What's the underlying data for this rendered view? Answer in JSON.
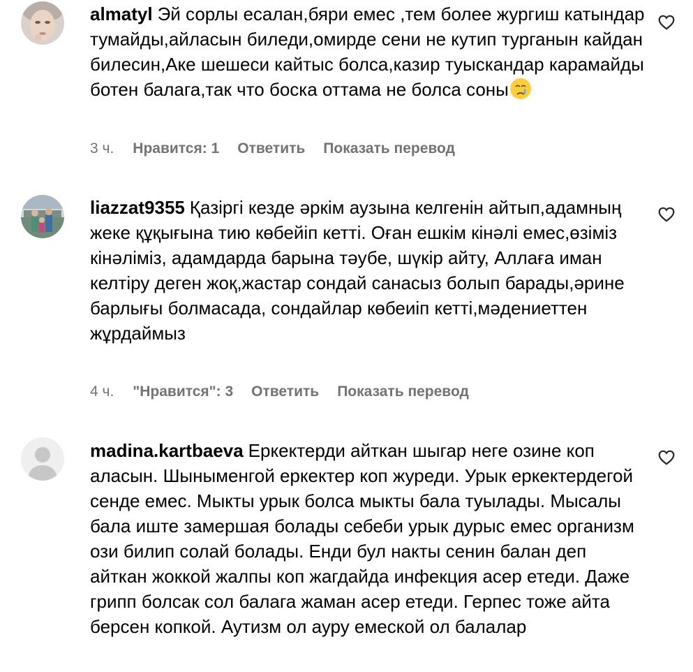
{
  "comments": [
    {
      "username": "almatyl",
      "text": "Эй сорлы есалан,бяри емес ,тем более жургиш катындар тумайды,айласын биледи,омирде сени не кутип турганын кайдан билесин,Аке шешеси кайтыс болса,казир туыскандар карамайды ботен балага,так что боска оттама не болса соны",
      "emoji": "crying-face",
      "time": "3 ч.",
      "likes": "Нравится: 1",
      "reply": "Ответить",
      "translate": "Показать перевод"
    },
    {
      "username": "liazzat9355",
      "text": "Қазіргі кезде әркім аузына келгенін айтып,адамның жеке құқығына тию көбейіп кетті. Оған ешкім кінәлі емес,өзіміз кінәліміз, адамдарда барына тәубе, шүкір айту, Аллаға иман келтіру деген жоқ,жастар сондай санасыз болып барады,әрине барлығы болмасада, сондайлар көбеиіп кетті,мәдениеттен жұрдаймыз",
      "time": "4 ч.",
      "likes": "\"Нравится\": 3",
      "reply": "Ответить",
      "translate": "Показать перевод"
    },
    {
      "username": "madina.kartbaeva",
      "text": "Еркектерди айткан шыгар неге озине коп аласын. Шыныменгой еркектер коп журеди. Урык еркектердегой сенде емес. Мыкты урык болса мыкты бала туылады. Мысалы бала иште замершая болады себеби урык дурыс емес организм ози билип солай болады. Енди бул накты сенин балан деп айткан жоккой жалпы коп жагдайда инфекция асер етеди. Даже грипп болсак сол балага жаман асер етеди. Герпес тоже айта берсен копкой. Аутизм ол ауру емеской ол балалар"
    }
  ]
}
